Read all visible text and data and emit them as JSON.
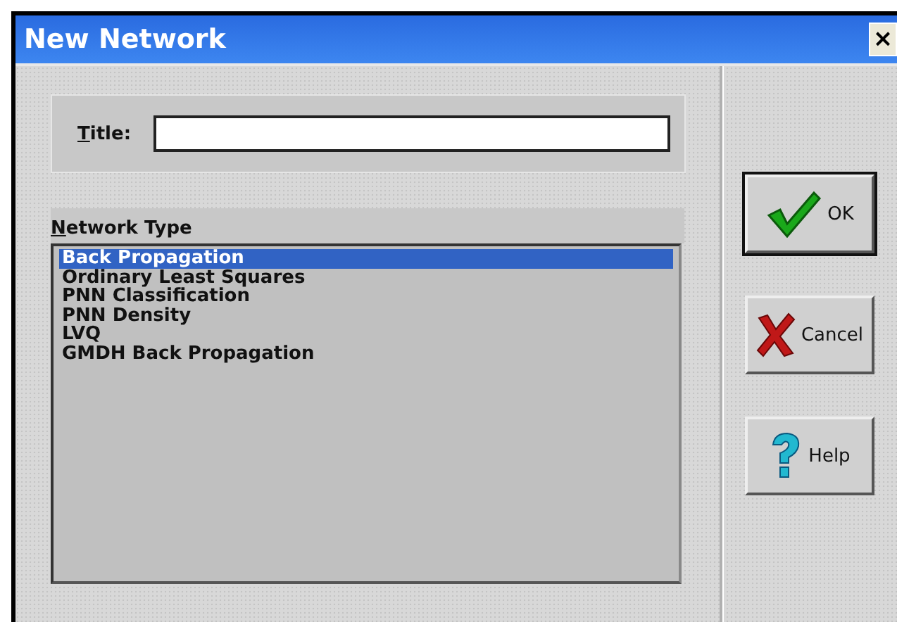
{
  "window": {
    "title": "New Network",
    "close": "×"
  },
  "title_field": {
    "label": "Title:"
  },
  "network_type": {
    "label": "Network Type",
    "items": [
      {
        "label": "Back Propagation",
        "selected": true
      },
      {
        "label": "Ordinary Least Squares",
        "selected": false
      },
      {
        "label": "PNN Classification",
        "selected": false
      },
      {
        "label": "PNN Density",
        "selected": false
      },
      {
        "label": "LVQ",
        "selected": false
      },
      {
        "label": "GMDH Back Propagation",
        "selected": false
      }
    ]
  },
  "buttons": [
    {
      "kind": "ok",
      "label": "OK",
      "default": true
    },
    {
      "kind": "cancel",
      "label": "Cancel",
      "default": false
    },
    {
      "kind": "help",
      "label": "Help",
      "default": false
    }
  ]
}
